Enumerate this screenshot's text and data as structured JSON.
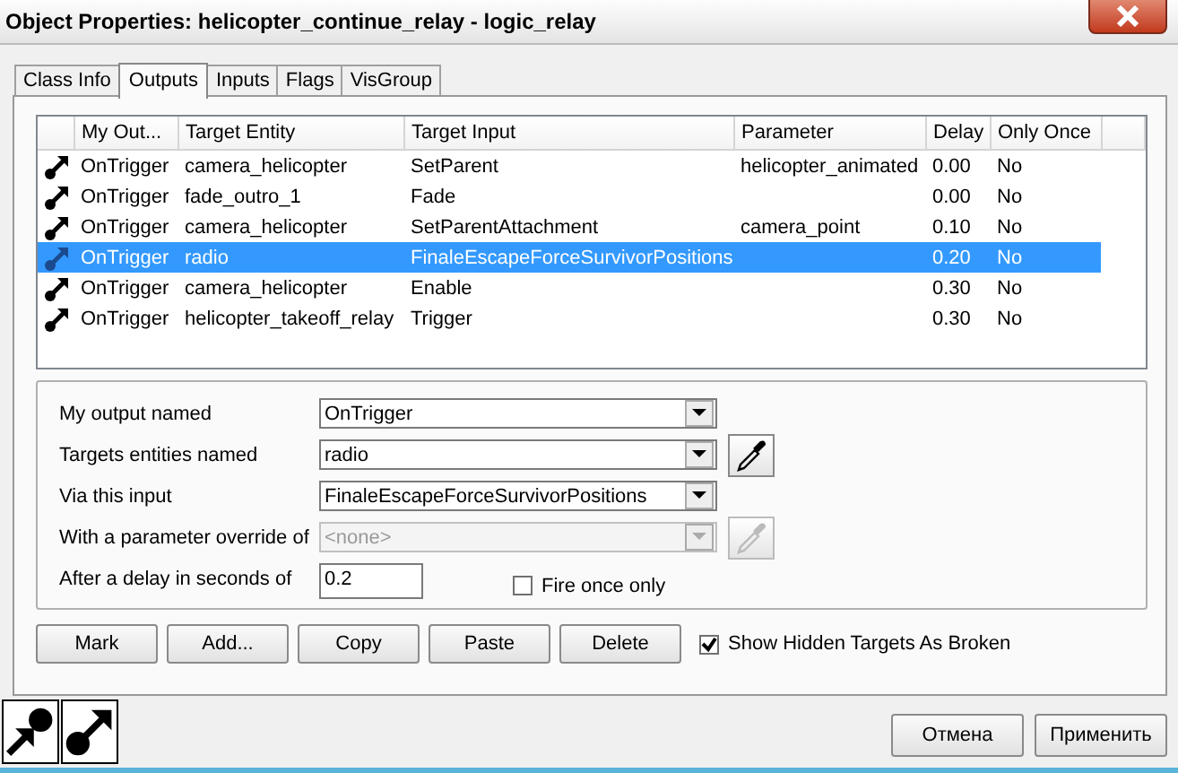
{
  "window": {
    "title": "Object Properties: helicopter_continue_relay - logic_relay"
  },
  "tabs": [
    {
      "label": "Class Info",
      "selected": false
    },
    {
      "label": "Outputs",
      "selected": true
    },
    {
      "label": "Inputs",
      "selected": false
    },
    {
      "label": "Flags",
      "selected": false
    },
    {
      "label": "VisGroup",
      "selected": false
    }
  ],
  "outputs": {
    "columns": [
      "My Out...",
      "Target Entity",
      "Target Input",
      "Parameter",
      "Delay",
      "Only Once"
    ],
    "rows": [
      {
        "cells": [
          "OnTrigger",
          "camera_helicopter",
          "SetParent",
          "helicopter_animated",
          "0.00",
          "No"
        ],
        "selected": false
      },
      {
        "cells": [
          "OnTrigger",
          "fade_outro_1",
          "Fade",
          "",
          "0.00",
          "No"
        ],
        "selected": false
      },
      {
        "cells": [
          "OnTrigger",
          "camera_helicopter",
          "SetParentAttachment",
          "camera_point",
          "0.10",
          "No"
        ],
        "selected": false
      },
      {
        "cells": [
          "OnTrigger",
          "radio",
          "FinaleEscapeForceSurvivorPositions",
          "",
          "0.20",
          "No"
        ],
        "selected": true
      },
      {
        "cells": [
          "OnTrigger",
          "camera_helicopter",
          "Enable",
          "",
          "0.30",
          "No"
        ],
        "selected": false
      },
      {
        "cells": [
          "OnTrigger",
          "helicopter_takeoff_relay",
          "Trigger",
          "",
          "0.30",
          "No"
        ],
        "selected": false
      }
    ]
  },
  "form": {
    "fields": [
      {
        "kind": "combo",
        "label": "My output named",
        "value": "OnTrigger",
        "disabled": false,
        "picker": false
      },
      {
        "kind": "combo",
        "label": "Targets entities named",
        "value": "radio",
        "disabled": false,
        "picker": true
      },
      {
        "kind": "combo",
        "label": "Via this input",
        "value": "FinaleEscapeForceSurvivorPositions",
        "disabled": false,
        "picker": false
      },
      {
        "kind": "combo",
        "label": "With a parameter override of",
        "value": "<none>",
        "disabled": true,
        "picker": true
      },
      {
        "kind": "text",
        "label": "After a delay in seconds of",
        "value": "0.2",
        "disabled": false,
        "picker": false
      }
    ],
    "fire_once": {
      "label": "Fire once only",
      "checked": false
    }
  },
  "buttons": [
    "Mark",
    "Add...",
    "Copy",
    "Paste",
    "Delete"
  ],
  "show_hidden": {
    "label": "Show Hidden Targets As Broken",
    "checked": true
  },
  "footer_buttons": [
    "Отмена",
    "Применить"
  ]
}
